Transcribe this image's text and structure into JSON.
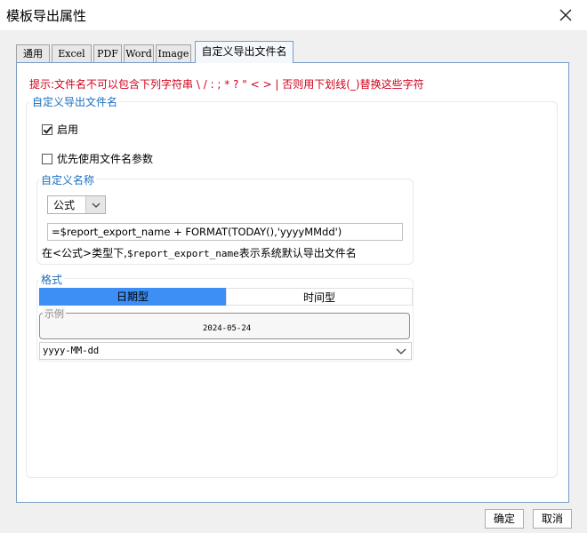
{
  "window": {
    "title": "模板导出属性",
    "close_icon": "close-icon"
  },
  "tabs": [
    {
      "label": "通用"
    },
    {
      "label": "Excel"
    },
    {
      "label": "PDF"
    },
    {
      "label": "Word"
    },
    {
      "label": "Image"
    },
    {
      "label": "自定义导出文件名",
      "active": true
    }
  ],
  "hint": "提示:文件名不可以包含下列字符串 \\ / : ; * ? \" < > |  否则用下划线(_)替换这些字符",
  "group_main": {
    "title": "自定义导出文件名",
    "enable": {
      "label": "启用",
      "checked": true
    },
    "prefer_param": {
      "label": "优先使用文件名参数",
      "checked": false
    }
  },
  "group_name": {
    "title": "自定义名称",
    "type_select": {
      "value": "公式"
    },
    "formula_input": {
      "value": "=$report_export_name + FORMAT(TODAY(),'yyyyMMdd')"
    },
    "note_prefix": "在<公式>类型下,",
    "note_var": "$report_export_name",
    "note_suffix": "表示系统默认导出文件名"
  },
  "group_format": {
    "title": "格式",
    "seg_date": "日期型",
    "seg_time": "时间型",
    "example_label": "示例",
    "example_value": "2024-05-24",
    "format_select": {
      "value": "yyyy-MM-dd"
    }
  },
  "buttons": {
    "ok": "确定",
    "cancel": "取消"
  },
  "colors": {
    "accent": "#3d8ef5",
    "hint": "#d0001b",
    "group_title": "#1a6fbf"
  }
}
